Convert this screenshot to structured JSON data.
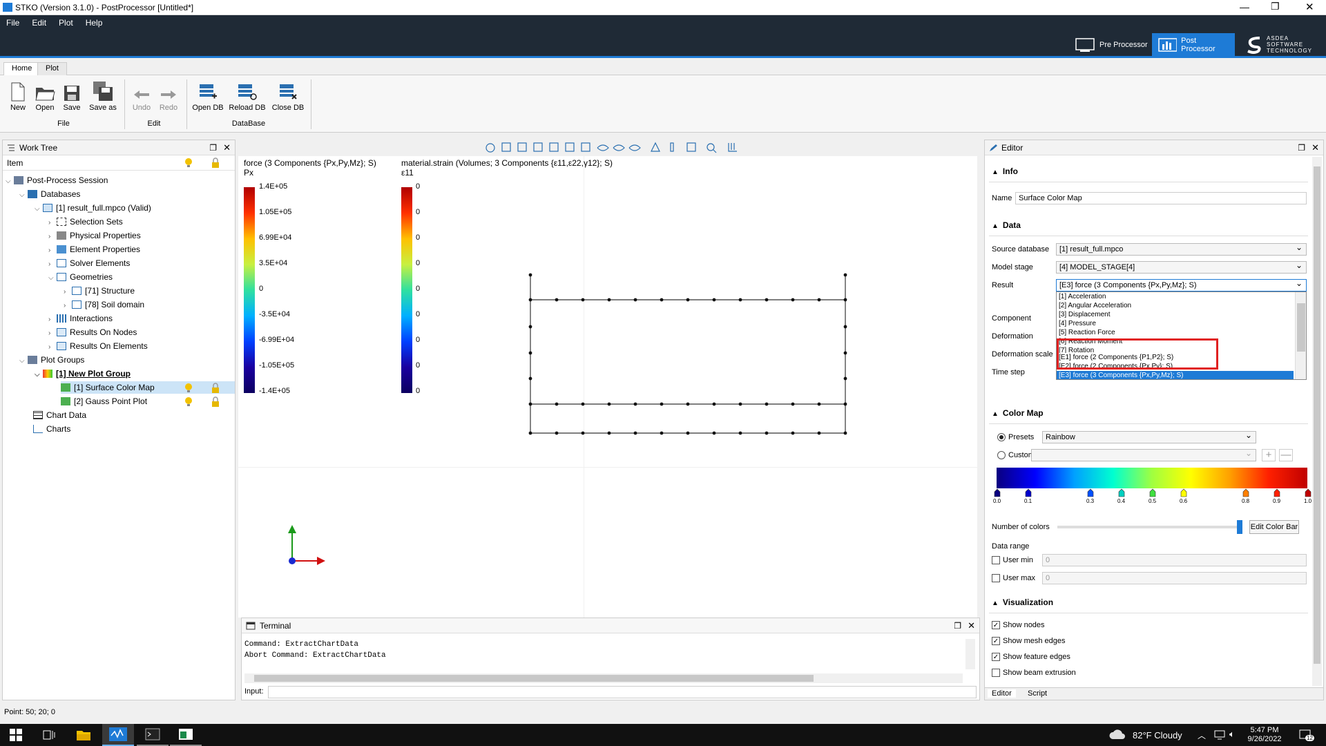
{
  "window": {
    "title": "STKO (Version 3.1.0) - PostProcessor [Untitled*]"
  },
  "menu": [
    "File",
    "Edit",
    "Plot",
    "Help"
  ],
  "modes": {
    "pre": "Pre Processor",
    "post": "Post Processor",
    "brand": "ASDEA SOFTWARE TECHNOLOGY"
  },
  "ribbon": {
    "tabs": [
      "Home",
      "Plot"
    ],
    "buttons": {
      "new": "New",
      "open": "Open",
      "save": "Save",
      "saveas": "Save as",
      "undo": "Undo",
      "redo": "Redo",
      "opendb": "Open DB",
      "reloaddb": "Reload DB",
      "closedb": "Close DB"
    },
    "groups": {
      "file": "File",
      "edit": "Edit",
      "db": "DataBase"
    }
  },
  "worktree": {
    "title": "Work Tree",
    "column": "Item",
    "items": [
      "Post-Process Session",
      "Databases",
      "[1] result_full.mpco (Valid)",
      "Selection Sets",
      "Physical Properties",
      "Element Properties",
      "Solver Elements",
      "Geometries",
      "[71] Structure",
      "[78] Soil domain",
      "Interactions",
      "Results On Nodes",
      "Results On Elements",
      "Plot Groups",
      "[1] New Plot Group",
      "[1] Surface Color Map",
      "[2] Gauss Point Plot",
      "Chart Data",
      "Charts"
    ]
  },
  "viewport": {
    "legend1": {
      "title": "force (3 Components {Px,Py,Mz}; S)",
      "sub": "Px",
      "ticks": [
        "1.4E+05",
        "1.05E+05",
        "6.99E+04",
        "3.5E+04",
        "0",
        "-3.5E+04",
        "-6.99E+04",
        "-1.05E+05",
        "-1.4E+05"
      ]
    },
    "legend2": {
      "title": "material.strain (Volumes; 3 Components {ε11,ε22,γ12}; S)",
      "sub": "ε11",
      "ticks": [
        "0",
        "0",
        "0",
        "0",
        "0",
        "0",
        "0",
        "0",
        "0"
      ]
    }
  },
  "terminal": {
    "title": "Terminal",
    "lines": [
      "Command: ExtractChartData",
      "Abort Command: ExtractChartData"
    ],
    "input_label": "Input:"
  },
  "editor": {
    "title": "Editor",
    "info": {
      "section": "Info",
      "name_label": "Name",
      "name_value": "Surface Color Map"
    },
    "data": {
      "section": "Data",
      "source_label": "Source database",
      "source_value": "[1] result_full.mpco",
      "stage_label": "Model stage",
      "stage_value": "[4] MODEL_STAGE[4]",
      "result_label": "Result",
      "result_value": "[E3] force (3 Components {Px,Py,Mz}; S)",
      "component_label": "Component",
      "deformation_label": "Deformation",
      "defscale_label": "Deformation scale",
      "timestep_label": "Time step",
      "dropdown": [
        "[1] Acceleration",
        "[2] Angular Acceleration",
        "[3] Displacement",
        "[4] Pressure",
        "[5] Reaction Force",
        "[6] Reaction Moment",
        "[7] Rotation",
        "[E1] force (2 Components {P1,P2}; S)",
        "[E2] force (2 Components {Px,Py}; S)",
        "[E3] force (3 Components {Px,Py,Mz}; S)"
      ]
    },
    "colormap": {
      "section": "Color Map",
      "presets_label": "Presets",
      "presets_value": "Rainbow",
      "custom_label": "Custom",
      "ticks": [
        "0.0",
        "0.1",
        "0.3",
        "0.4",
        "0.5",
        "0.6",
        "0.8",
        "0.9",
        "1.0"
      ],
      "ncolors_label": "Number of colors",
      "edit_button": "Edit Color Bar",
      "range_label": "Data range",
      "usermin_label": "User min",
      "usermin_value": "0",
      "usermax_label": "User max",
      "usermax_value": "0"
    },
    "visualization": {
      "section": "Visualization",
      "items": [
        "Show nodes",
        "Show mesh edges",
        "Show feature edges",
        "Show beam extrusion"
      ]
    },
    "tabs": [
      "Editor",
      "Script"
    ]
  },
  "status": {
    "text": "Point: 50; 20; 0"
  },
  "taskbar": {
    "weather": "82°F  Cloudy",
    "time": "5:47 PM",
    "date": "9/26/2022",
    "badge": "12"
  }
}
